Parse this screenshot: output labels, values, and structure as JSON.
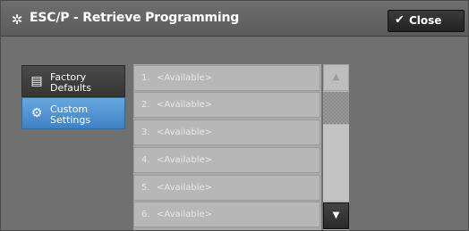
{
  "header": {
    "icon": "gear-icon",
    "title": "ESC/P - Retrieve Programming",
    "close_label": "Close",
    "close_icon": "checkmark-icon"
  },
  "tabs": [
    {
      "line1": "Factory",
      "line2": "Defaults",
      "icon": "document-icon",
      "selected": false
    },
    {
      "line1": "Custom",
      "line2": "Settings",
      "icon": "gear-icon",
      "selected": true
    }
  ],
  "list": {
    "items": [
      {
        "num": "1.",
        "text": "<Available>"
      },
      {
        "num": "2.",
        "text": "<Available>"
      },
      {
        "num": "3.",
        "text": "<Available>"
      },
      {
        "num": "4.",
        "text": "<Available>"
      },
      {
        "num": "5.",
        "text": "<Available>"
      },
      {
        "num": "6.",
        "text": "<Available>"
      }
    ]
  },
  "scrollbar": {
    "up_icon": "triangle-up-icon",
    "down_icon": "triangle-down-icon"
  },
  "colors": {
    "header_bg": "#5e5e5e",
    "accent_selected": "#4f93d3",
    "close_bg": "#2c2c2c"
  }
}
